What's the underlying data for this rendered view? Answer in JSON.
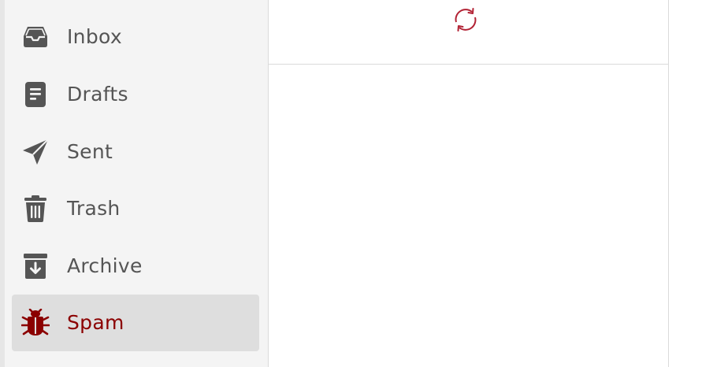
{
  "sidebar": {
    "items": [
      {
        "label": "Inbox",
        "icon": "inbox-icon",
        "active": false
      },
      {
        "label": "Drafts",
        "icon": "drafts-icon",
        "active": false
      },
      {
        "label": "Sent",
        "icon": "sent-icon",
        "active": false
      },
      {
        "label": "Trash",
        "icon": "trash-icon",
        "active": false
      },
      {
        "label": "Archive",
        "icon": "archive-icon",
        "active": false
      },
      {
        "label": "Spam",
        "icon": "bug-icon",
        "active": true
      }
    ]
  },
  "content": {
    "refresh_icon": "refresh-icon"
  },
  "colors": {
    "accent": "#8b0000",
    "icon": "#555555",
    "sidebar_bg": "#f4f4f4",
    "active_bg": "#dedede",
    "refresh": "#b22234"
  }
}
